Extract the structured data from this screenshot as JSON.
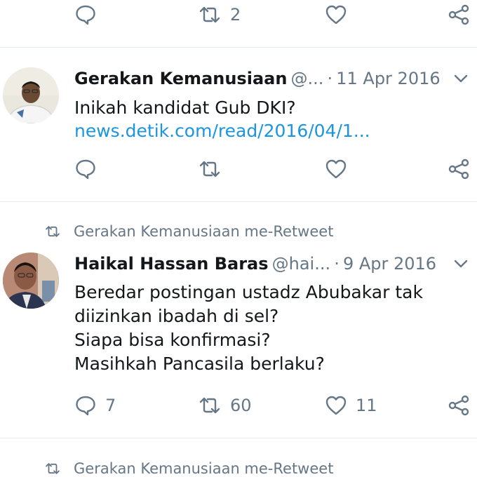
{
  "top_actions": {
    "retweet_count": "2"
  },
  "tweet1": {
    "name": "Gerakan Kemanusiaan",
    "handle": "@...",
    "date": "11 Apr 2016",
    "text": "Inikah kandidat Gub DKI?",
    "link": "news.detik.com/read/2016/04/1..."
  },
  "tweet2": {
    "retweet_label": "Gerakan Kemanusiaan me-Retweet",
    "name": "Haikal Hassan Baras",
    "handle": "@hai...",
    "date": "9 Apr 2016",
    "lines": [
      "Beredar postingan ustadz Abubakar tak",
      "diizinkan ibadah di sel?",
      "Siapa bisa konfirmasi?",
      "Masihkah Pancasila berlaku?"
    ],
    "reply_count": "7",
    "retweet_count": "60",
    "like_count": "11"
  },
  "tweet3": {
    "retweet_label": "Gerakan Kemanusiaan me-Retweet"
  },
  "separator": "·",
  "icons": [
    "reply-icon",
    "retweet-icon",
    "like-icon",
    "share-icon",
    "chevron-down-icon"
  ]
}
